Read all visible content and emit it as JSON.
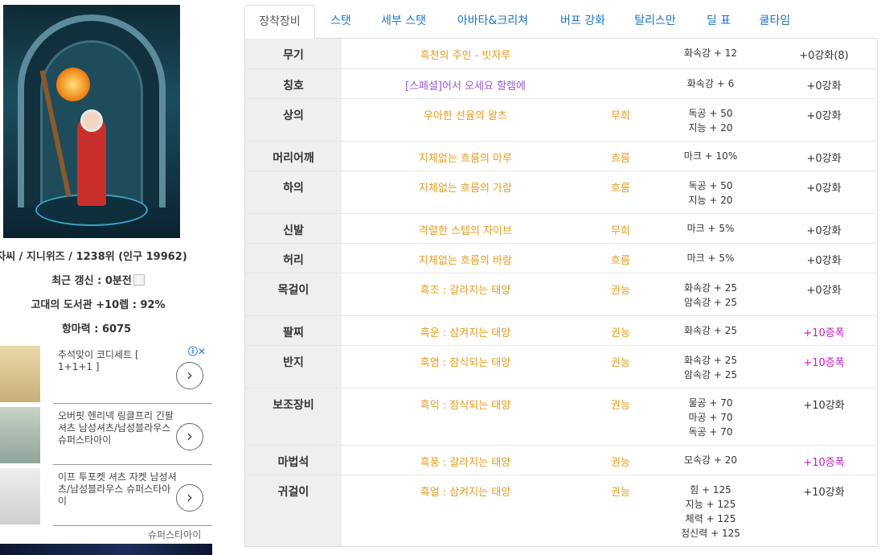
{
  "profile": {
    "rank_line": "자씨 / 지니위즈 / 1238위 (인구 19962)",
    "update_label": "최근 갱신 : 0분전",
    "library_line": "고대의 도서관 +10렙 : 92%",
    "attack_line": "항마력 : 6075"
  },
  "ad": {
    "choices_icon": "ⓘ✕",
    "items": [
      {
        "text": "추석맞이 코디세트 [ 1+1+1 ]"
      },
      {
        "text": "오버핏 헨리넥 링클프리 긴팔셔츠 남성셔츠/남성블라우스 슈퍼스타아이"
      },
      {
        "text": "이프 투포켓 셔츠 자켓 남성셔츠/남성블라우스 슈퍼스타아이"
      }
    ],
    "footer": "슈퍼스타아이",
    "arrow_icon": "chevron-right-icon"
  },
  "tabs": [
    {
      "label": "장착장비"
    },
    {
      "label": "스탯"
    },
    {
      "label": "세부 스탯"
    },
    {
      "label": "아바타&크리쳐"
    },
    {
      "label": "버프 강화"
    },
    {
      "label": "탈리스만"
    },
    {
      "label": "딜 표"
    },
    {
      "label": "쿨타임"
    }
  ],
  "equipment": [
    {
      "slot": "무기",
      "name": "흑천의 주인 - 빗자루",
      "name_color": "orange",
      "set": "",
      "stats": [
        "화속강 + 12"
      ],
      "enhance": "+0강화(8)",
      "enhance_color": "normal"
    },
    {
      "slot": "칭호",
      "name": "[스페셜]어서 오세요 할렘에",
      "name_color": "purple",
      "set": "",
      "stats": [
        "화속강 + 6"
      ],
      "enhance": "+0강화",
      "enhance_color": "normal"
    },
    {
      "slot": "상의",
      "name": "우아한 선율의 왈츠",
      "name_color": "orange",
      "set": "무희",
      "stats": [
        "독공 + 50",
        "지능 + 20"
      ],
      "enhance": "+0강화",
      "enhance_color": "normal"
    },
    {
      "slot": "머리어깨",
      "name": "지체없는 흐름의 마루",
      "name_color": "orange",
      "set": "흐름",
      "stats": [
        "마크 + 10%"
      ],
      "enhance": "+0강화",
      "enhance_color": "normal"
    },
    {
      "slot": "하의",
      "name": "지체없는 흐름의 가람",
      "name_color": "orange",
      "set": "흐름",
      "stats": [
        "독공 + 50",
        "지능 + 20"
      ],
      "enhance": "+0강화",
      "enhance_color": "normal"
    },
    {
      "slot": "신발",
      "name": "격렬한 스텝의 자이브",
      "name_color": "orange",
      "set": "무희",
      "stats": [
        "마크 + 5%"
      ],
      "enhance": "+0강화",
      "enhance_color": "normal"
    },
    {
      "slot": "허리",
      "name": "지체없는 흐름의 바람",
      "name_color": "orange",
      "set": "흐름",
      "stats": [
        "마크 + 5%"
      ],
      "enhance": "+0강화",
      "enhance_color": "normal"
    },
    {
      "slot": "목걸이",
      "name": "흑조 : 갈라지는 태양",
      "name_color": "orange",
      "set": "권능",
      "stats": [
        "화속강 + 25",
        "암속강 + 25"
      ],
      "enhance": "+0강화",
      "enhance_color": "normal"
    },
    {
      "slot": "팔찌",
      "name": "흑운 : 삼켜지는 태양",
      "name_color": "orange",
      "set": "권능",
      "stats": [
        "화속강 + 25"
      ],
      "enhance": "+10증폭",
      "enhance_color": "magenta"
    },
    {
      "slot": "반지",
      "name": "흑염 : 잠식되는 태양",
      "name_color": "orange",
      "set": "권능",
      "stats": [
        "화속강 + 25",
        "암속강 + 25"
      ],
      "enhance": "+10증폭",
      "enhance_color": "magenta"
    },
    {
      "slot": "보조장비",
      "name": "흑익 : 잠식되는 태양",
      "name_color": "orange",
      "set": "권능",
      "stats": [
        "물공 + 70",
        "마공 + 70",
        "독공 + 70"
      ],
      "enhance": "+10강화",
      "enhance_color": "normal"
    },
    {
      "slot": "마법석",
      "name": "흑풍 : 갈라지는 태양",
      "name_color": "orange",
      "set": "권능",
      "stats": [
        "모속강 + 20"
      ],
      "enhance": "+10증폭",
      "enhance_color": "magenta"
    },
    {
      "slot": "귀걸이",
      "name": "흑얼 : 삼켜지는 태양",
      "name_color": "orange",
      "set": "권능",
      "stats": [
        "힘 + 125",
        "지능 + 125",
        "체력 + 125",
        "정신력 + 125"
      ],
      "enhance": "+10강화",
      "enhance_color": "normal"
    }
  ],
  "colors": {
    "epic_orange": "#e39c1e",
    "title_purple": "#9b59d0",
    "amplify_magenta": "#c51dbe",
    "tab_link": "#1a73c8"
  }
}
